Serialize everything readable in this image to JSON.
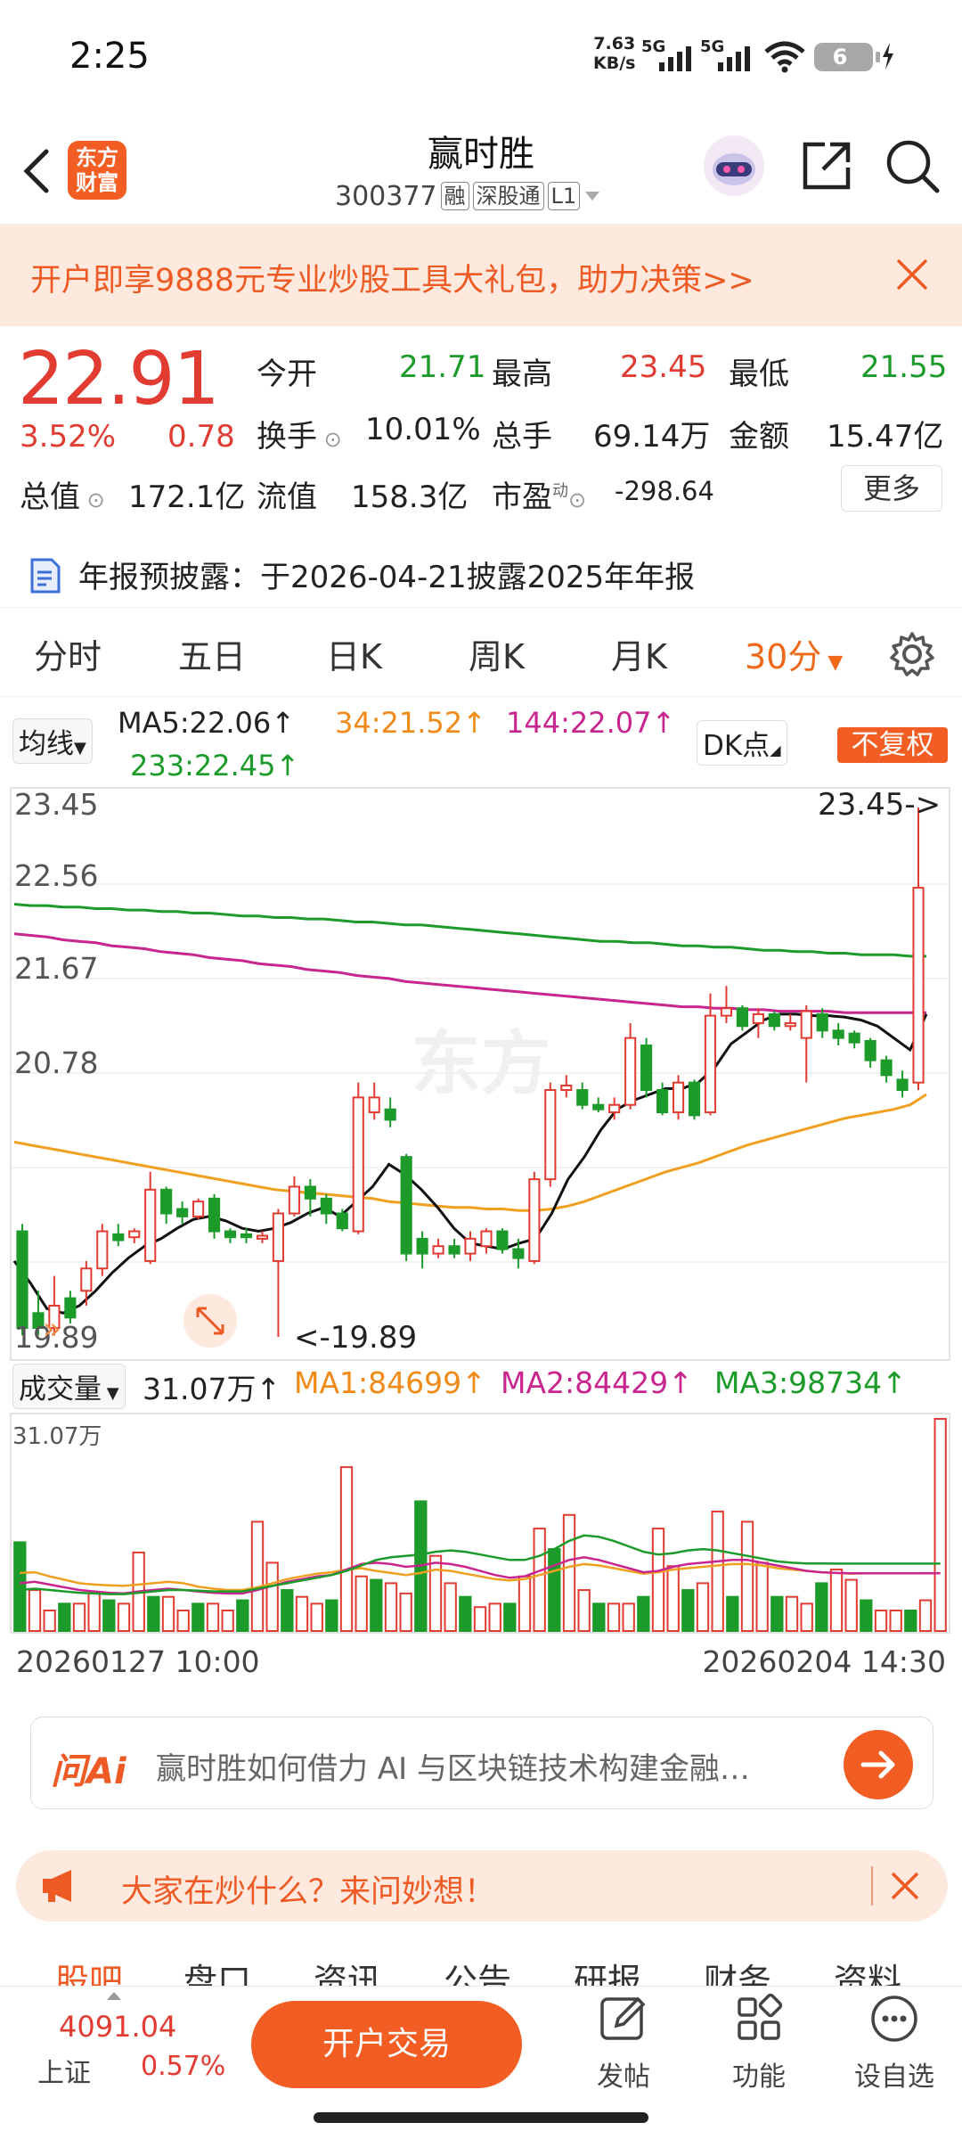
{
  "status_bar": {
    "time": "2:25",
    "net_speed_value": "7.63",
    "net_speed_unit": "KB/s",
    "signal1": "5G",
    "signal2": "5G",
    "battery": "6"
  },
  "header": {
    "logo_text_1": "东方",
    "logo_text_2": "财富",
    "stock_name": "赢时胜",
    "stock_code": "300377",
    "tag_margin": "融",
    "tag_connect": "深股通",
    "tag_level": "L1"
  },
  "promo": {
    "text": "开户即享9888元专业炒股工具大礼包，助力决策>>"
  },
  "quote": {
    "price": "22.91",
    "change_pct": "3.52%",
    "change": "0.78",
    "open_label": "今开",
    "open": "21.71",
    "high_label": "最高",
    "high": "23.45",
    "low_label": "最低",
    "low": "21.55",
    "turnover_label": "换手",
    "turnover": "10.01%",
    "volume_label": "总手",
    "volume": "69.14万",
    "amount_label": "金额",
    "amount": "15.47亿",
    "mktcap_label": "总值",
    "mktcap": "172.1亿",
    "float_label": "流值",
    "float": "158.3亿",
    "pe_label": "市盈",
    "pe_sup": "动",
    "pe": "-298.64",
    "more": "更多"
  },
  "report": {
    "text": "年报预披露：于2026-04-21披露2025年年报"
  },
  "tabs": [
    "分时",
    "五日",
    "日K",
    "周K",
    "月K",
    "30分"
  ],
  "ma": {
    "selector": "均线",
    "ma5": "MA5:22.06",
    "ma34": "34:21.52",
    "ma144": "144:22.07",
    "ma233": "233:22.45",
    "dk": "DK点",
    "fq": "不复权"
  },
  "chart_data": {
    "type": "candlestick",
    "y_ticks": [
      "23.45",
      "22.56",
      "21.67",
      "20.78",
      "19.89"
    ],
    "ylim": [
      19.89,
      23.45
    ],
    "max_label": "23.45->",
    "min_label": "<-19.89",
    "candles": [
      {
        "o": 20.6,
        "c": 19.95,
        "h": 20.65,
        "l": 19.9
      },
      {
        "o": 20.05,
        "c": 19.95,
        "h": 20.2,
        "l": 19.9
      },
      {
        "o": 19.95,
        "c": 20.1,
        "h": 20.3,
        "l": 19.9
      },
      {
        "o": 20.15,
        "c": 20.02,
        "h": 20.2,
        "l": 19.98
      },
      {
        "o": 20.2,
        "c": 20.35,
        "h": 20.4,
        "l": 20.1
      },
      {
        "o": 20.35,
        "c": 20.6,
        "h": 20.65,
        "l": 20.3
      },
      {
        "o": 20.58,
        "c": 20.54,
        "h": 20.65,
        "l": 20.5
      },
      {
        "o": 20.56,
        "c": 20.6,
        "h": 20.62,
        "l": 20.52
      },
      {
        "o": 20.4,
        "c": 20.88,
        "h": 21.0,
        "l": 20.38
      },
      {
        "o": 20.88,
        "c": 20.72,
        "h": 20.9,
        "l": 20.65
      },
      {
        "o": 20.75,
        "c": 20.7,
        "h": 20.8,
        "l": 20.65
      },
      {
        "o": 20.7,
        "c": 20.8,
        "h": 20.82,
        "l": 20.68
      },
      {
        "o": 20.82,
        "c": 20.6,
        "h": 20.85,
        "l": 20.55
      },
      {
        "o": 20.6,
        "c": 20.56,
        "h": 20.62,
        "l": 20.52
      },
      {
        "o": 20.58,
        "c": 20.56,
        "h": 20.62,
        "l": 20.52
      },
      {
        "o": 20.55,
        "c": 20.57,
        "h": 20.6,
        "l": 20.52
      },
      {
        "o": 20.4,
        "c": 20.72,
        "h": 20.75,
        "l": 19.89
      },
      {
        "o": 20.72,
        "c": 20.9,
        "h": 20.97,
        "l": 20.7
      },
      {
        "o": 20.9,
        "c": 20.82,
        "h": 20.95,
        "l": 20.7
      },
      {
        "o": 20.82,
        "c": 20.72,
        "h": 20.85,
        "l": 20.65
      },
      {
        "o": 20.72,
        "c": 20.62,
        "h": 20.75,
        "l": 20.6
      },
      {
        "o": 20.6,
        "c": 21.5,
        "h": 21.6,
        "l": 20.58
      },
      {
        "o": 21.4,
        "c": 21.5,
        "h": 21.6,
        "l": 21.35
      },
      {
        "o": 21.42,
        "c": 21.35,
        "h": 21.5,
        "l": 21.3
      },
      {
        "o": 21.1,
        "c": 20.45,
        "h": 21.12,
        "l": 20.4
      },
      {
        "o": 20.55,
        "c": 20.45,
        "h": 20.6,
        "l": 20.35
      },
      {
        "o": 20.45,
        "c": 20.5,
        "h": 20.55,
        "l": 20.42
      },
      {
        "o": 20.5,
        "c": 20.45,
        "h": 20.55,
        "l": 20.42
      },
      {
        "o": 20.45,
        "c": 20.55,
        "h": 20.6,
        "l": 20.4
      },
      {
        "o": 20.5,
        "c": 20.6,
        "h": 20.62,
        "l": 20.45
      },
      {
        "o": 20.6,
        "c": 20.48,
        "h": 20.62,
        "l": 20.45
      },
      {
        "o": 20.48,
        "c": 20.42,
        "h": 20.55,
        "l": 20.35
      },
      {
        "o": 20.4,
        "c": 20.95,
        "h": 21.0,
        "l": 20.38
      },
      {
        "o": 20.95,
        "c": 21.55,
        "h": 21.6,
        "l": 20.9
      },
      {
        "o": 21.55,
        "c": 21.58,
        "h": 21.65,
        "l": 21.5
      },
      {
        "o": 21.55,
        "c": 21.45,
        "h": 21.6,
        "l": 21.42
      },
      {
        "o": 21.45,
        "c": 21.42,
        "h": 21.5,
        "l": 21.4
      },
      {
        "o": 21.4,
        "c": 21.45,
        "h": 21.5,
        "l": 21.35
      },
      {
        "o": 21.45,
        "c": 21.9,
        "h": 22.0,
        "l": 21.42
      },
      {
        "o": 21.85,
        "c": 21.55,
        "h": 21.9,
        "l": 21.5
      },
      {
        "o": 21.55,
        "c": 21.4,
        "h": 21.6,
        "l": 21.38
      },
      {
        "o": 21.4,
        "c": 21.6,
        "h": 21.65,
        "l": 21.35
      },
      {
        "o": 21.6,
        "c": 21.38,
        "h": 21.62,
        "l": 21.35
      },
      {
        "o": 21.4,
        "c": 22.05,
        "h": 22.2,
        "l": 21.38
      },
      {
        "o": 22.05,
        "c": 22.1,
        "h": 22.25,
        "l": 22.0
      },
      {
        "o": 22.1,
        "c": 21.98,
        "h": 22.12,
        "l": 21.95
      },
      {
        "o": 22.0,
        "c": 22.06,
        "h": 22.1,
        "l": 21.9
      },
      {
        "o": 22.06,
        "c": 21.98,
        "h": 22.08,
        "l": 21.95
      },
      {
        "o": 21.98,
        "c": 22.0,
        "h": 22.06,
        "l": 21.95
      },
      {
        "o": 21.9,
        "c": 22.08,
        "h": 22.12,
        "l": 21.6
      },
      {
        "o": 22.06,
        "c": 21.95,
        "h": 22.1,
        "l": 21.9
      },
      {
        "o": 21.95,
        "c": 21.9,
        "h": 22.0,
        "l": 21.85
      },
      {
        "o": 21.93,
        "c": 21.87,
        "h": 21.95,
        "l": 21.83
      },
      {
        "o": 21.88,
        "c": 21.75,
        "h": 21.9,
        "l": 21.7
      },
      {
        "o": 21.75,
        "c": 21.65,
        "h": 21.78,
        "l": 21.6
      },
      {
        "o": 21.62,
        "c": 21.55,
        "h": 21.68,
        "l": 21.5
      },
      {
        "o": 21.6,
        "c": 22.91,
        "h": 23.45,
        "l": 21.55
      }
    ],
    "ma5": [
      20.4,
      20.25,
      20.08,
      20.05,
      20.1,
      20.2,
      20.32,
      20.42,
      20.5,
      20.55,
      20.62,
      20.68,
      20.7,
      20.67,
      20.62,
      20.6,
      20.62,
      20.66,
      20.72,
      20.76,
      20.7,
      20.8,
      20.9,
      21.05,
      20.98,
      20.88,
      20.76,
      20.62,
      20.52,
      20.5,
      20.48,
      20.52,
      20.55,
      20.72,
      20.95,
      21.1,
      21.28,
      21.42,
      21.48,
      21.52,
      21.56,
      21.56,
      21.6,
      21.7,
      21.86,
      21.94,
      22.02,
      22.06,
      22.06,
      22.05,
      22.05,
      22.04,
      22.02,
      21.98,
      21.9,
      21.82,
      22.06
    ],
    "ma34": [
      21.2,
      21.18,
      21.16,
      21.14,
      21.12,
      21.1,
      21.08,
      21.06,
      21.04,
      21.02,
      21.0,
      20.98,
      20.96,
      20.94,
      20.92,
      20.9,
      20.88,
      20.87,
      20.86,
      20.85,
      20.84,
      20.83,
      20.82,
      20.8,
      20.79,
      20.78,
      20.77,
      20.76,
      20.76,
      20.75,
      20.75,
      20.74,
      20.74,
      20.75,
      20.77,
      20.8,
      20.84,
      20.88,
      20.92,
      20.96,
      21.0,
      21.03,
      21.06,
      21.1,
      21.14,
      21.18,
      21.21,
      21.24,
      21.27,
      21.3,
      21.33,
      21.36,
      21.38,
      21.4,
      21.42,
      21.45,
      21.52
    ],
    "ma144": [
      22.6,
      22.59,
      22.58,
      22.56,
      22.55,
      22.54,
      22.52,
      22.51,
      22.5,
      22.48,
      22.47,
      22.46,
      22.44,
      22.43,
      22.42,
      22.4,
      22.39,
      22.38,
      22.36,
      22.35,
      22.34,
      22.32,
      22.31,
      22.3,
      22.28,
      22.27,
      22.26,
      22.25,
      22.24,
      22.23,
      22.22,
      22.21,
      22.2,
      22.19,
      22.18,
      22.17,
      22.16,
      22.15,
      22.14,
      22.13,
      22.12,
      22.11,
      22.11,
      22.1,
      22.1,
      22.09,
      22.09,
      22.08,
      22.08,
      22.08,
      22.08,
      22.07,
      22.07,
      22.07,
      22.07,
      22.07,
      22.07
    ],
    "ma233": [
      22.8,
      22.79,
      22.79,
      22.78,
      22.78,
      22.77,
      22.77,
      22.76,
      22.76,
      22.75,
      22.75,
      22.74,
      22.74,
      22.73,
      22.72,
      22.72,
      22.71,
      22.71,
      22.7,
      22.7,
      22.69,
      22.68,
      22.68,
      22.67,
      22.66,
      22.66,
      22.65,
      22.64,
      22.63,
      22.62,
      22.61,
      22.6,
      22.59,
      22.58,
      22.57,
      22.56,
      22.55,
      22.55,
      22.54,
      22.54,
      22.53,
      22.52,
      22.52,
      22.51,
      22.51,
      22.5,
      22.49,
      22.49,
      22.48,
      22.48,
      22.47,
      22.47,
      22.46,
      22.46,
      22.46,
      22.45,
      22.45
    ],
    "x_labels": [
      "20260127 10:00",
      "20260204 14:30"
    ],
    "volume": {
      "label": "成交量",
      "value": "31.07万",
      "max_label": "31.07万",
      "ma1": "MA1:84699",
      "ma2": "MA2:84429",
      "ma3": "MA3:98734",
      "ylim": [
        0,
        310700
      ],
      "values": [
        130000,
        60000,
        30000,
        40000,
        40000,
        55000,
        45000,
        40000,
        115000,
        50000,
        50000,
        30000,
        40000,
        40000,
        30000,
        45000,
        160000,
        100000,
        60000,
        50000,
        40000,
        45000,
        240000,
        80000,
        75000,
        70000,
        55000,
        190000,
        110000,
        70000,
        50000,
        35000,
        40000,
        40000,
        80000,
        150000,
        120000,
        170000,
        60000,
        40000,
        40000,
        40000,
        50000,
        150000,
        95000,
        60000,
        70000,
        175000,
        50000,
        160000,
        100000,
        50000,
        50000,
        40000,
        70000,
        90000,
        75000,
        45000,
        30000,
        30000,
        30000,
        45000,
        310700
      ],
      "ma1_line": [
        85000,
        86000,
        80000,
        75000,
        70000,
        68000,
        67000,
        66000,
        68000,
        70000,
        72000,
        70000,
        65000,
        62000,
        60000,
        60000,
        64000,
        70000,
        76000,
        80000,
        84000,
        86000,
        90000,
        92000,
        88000,
        85000,
        82000,
        85000,
        90000,
        88000,
        84000,
        80000,
        76000,
        74000,
        76000,
        82000,
        88000,
        94000,
        98000,
        96000,
        92000,
        88000,
        84000,
        86000,
        90000,
        92000,
        94000,
        96000,
        98000,
        98000,
        96000,
        92000,
        90000,
        88000,
        86000,
        85000,
        84000,
        84500,
        84500,
        84600,
        84650,
        84680,
        84699
      ],
      "ma2_line": [
        70000,
        72000,
        68000,
        64000,
        60000,
        58000,
        56000,
        55000,
        58000,
        60000,
        62000,
        60000,
        58000,
        56000,
        55000,
        55000,
        60000,
        66000,
        72000,
        76000,
        80000,
        82000,
        90000,
        98000,
        100000,
        98000,
        94000,
        96000,
        100000,
        98000,
        94000,
        88000,
        82000,
        78000,
        80000,
        88000,
        96000,
        104000,
        108000,
        104000,
        98000,
        92000,
        86000,
        88000,
        94000,
        98000,
        100000,
        102000,
        104000,
        104000,
        100000,
        96000,
        92000,
        88000,
        86000,
        85000,
        84500,
        84400,
        84400,
        84420,
        84425,
        84428,
        84429
      ],
      "ma3_line": [
        60000,
        62000,
        60000,
        58000,
        56000,
        55000,
        54000,
        54000,
        56000,
        58000,
        60000,
        60000,
        59000,
        58000,
        58000,
        58000,
        62000,
        66000,
        70000,
        74000,
        78000,
        82000,
        88000,
        96000,
        104000,
        108000,
        110000,
        112000,
        116000,
        118000,
        116000,
        112000,
        108000,
        104000,
        104000,
        110000,
        120000,
        132000,
        140000,
        138000,
        132000,
        124000,
        116000,
        112000,
        114000,
        118000,
        120000,
        118000,
        114000,
        110000,
        106000,
        102000,
        100000,
        99000,
        98800,
        98750,
        98740,
        98738,
        98736,
        98735,
        98735,
        98734,
        98734
      ]
    }
  },
  "ai": {
    "logo": "问Ai",
    "prompt": "赢时胜如何借力 AI 与区块链技术构建金融…"
  },
  "hot": {
    "text": "大家在炒什么？来问妙想！"
  },
  "subtabs": [
    "股吧",
    "盘口",
    "资讯",
    "公告",
    "研报",
    "财务",
    "资料"
  ],
  "bottom": {
    "index_value": "4091.04",
    "index_name": "上证",
    "index_change": "0.57%",
    "trade": "开户交易",
    "post": "发帖",
    "function": "功能",
    "watch": "设自选"
  },
  "colors": {
    "up": "#e23b31",
    "down": "#1c9b2a",
    "accent": "#f25d23",
    "ma34": "#f0a020",
    "ma144": "#c8258f",
    "ma233": "#1c9b2a"
  }
}
